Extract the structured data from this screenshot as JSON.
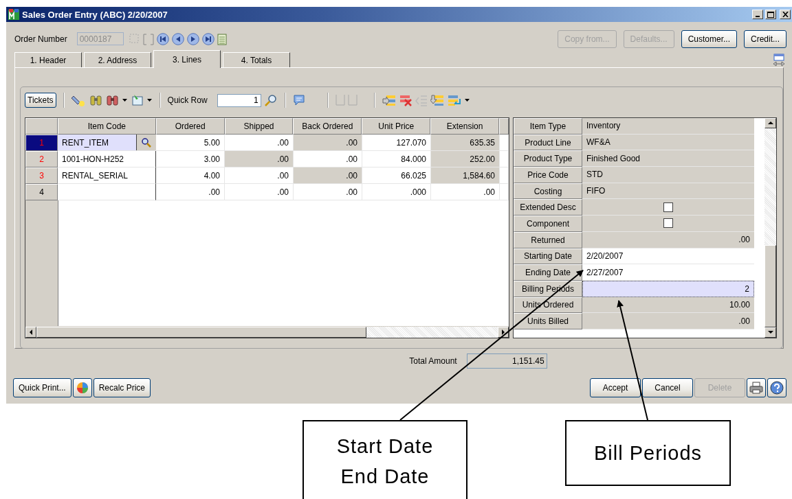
{
  "window": {
    "title": "Sales Order Entry (ABC) 2/20/2007"
  },
  "order": {
    "label": "Order Number",
    "value": "0000187",
    "disabled": true
  },
  "top_buttons": [
    {
      "label": "Copy from...",
      "disabled": true
    },
    {
      "label": "Defaults...",
      "disabled": true
    },
    {
      "label": "Customer...",
      "disabled": false
    },
    {
      "label": "Credit...",
      "disabled": false
    }
  ],
  "tabs": [
    {
      "label": "1. Header",
      "selected": false
    },
    {
      "label": "2. Address",
      "selected": false
    },
    {
      "label": "3. Lines",
      "selected": true
    },
    {
      "label": "4. Totals",
      "selected": false
    }
  ],
  "toolbar": {
    "tickets": "Tickets",
    "quick_row_label": "Quick Row",
    "quick_row_value": "1"
  },
  "grid": {
    "columns": [
      "Item Code",
      "Ordered",
      "Shipped",
      "Back Ordered",
      "Unit Price",
      "Extension"
    ],
    "rows": [
      {
        "number": "1",
        "color": "#ff0000",
        "selected": true,
        "cells": [
          {
            "text": "RENT_ITEM",
            "disabled": false
          },
          {
            "text": "5.00",
            "disabled": false
          },
          {
            "text": ".00",
            "disabled": false
          },
          {
            "text": ".00",
            "disabled": true
          },
          {
            "text": "127.070",
            "disabled": false
          },
          {
            "text": "635.35",
            "disabled": true
          }
        ]
      },
      {
        "number": "2",
        "color": "#ff0000",
        "selected": false,
        "cells": [
          {
            "text": "1001-HON-H252",
            "disabled": false
          },
          {
            "text": "3.00",
            "disabled": false
          },
          {
            "text": ".00",
            "disabled": true
          },
          {
            "text": ".00",
            "disabled": false
          },
          {
            "text": "84.000",
            "disabled": false
          },
          {
            "text": "252.00",
            "disabled": true
          }
        ]
      },
      {
        "number": "3",
        "color": "#ff0000",
        "selected": false,
        "cells": [
          {
            "text": "RENTAL_SERIAL",
            "disabled": false
          },
          {
            "text": "4.00",
            "disabled": false
          },
          {
            "text": ".00",
            "disabled": false
          },
          {
            "text": ".00",
            "disabled": true
          },
          {
            "text": "66.025",
            "disabled": false
          },
          {
            "text": "1,584.60",
            "disabled": true
          }
        ]
      },
      {
        "number": "4",
        "color": "#000000",
        "selected": false,
        "cells": [
          {
            "text": "",
            "disabled": false
          },
          {
            "text": ".00",
            "disabled": false
          },
          {
            "text": ".00",
            "disabled": false
          },
          {
            "text": ".00",
            "disabled": false
          },
          {
            "text": ".000",
            "disabled": false
          },
          {
            "text": ".00",
            "disabled": false
          }
        ]
      }
    ]
  },
  "properties": [
    {
      "label": "Item Type",
      "kind": "text",
      "value": "Inventory",
      "editable": false,
      "focused": false
    },
    {
      "label": "Product Line",
      "kind": "text",
      "value": "WF&A",
      "editable": false,
      "focused": false
    },
    {
      "label": "Product Type",
      "kind": "text",
      "value": "Finished Good",
      "editable": false,
      "focused": false
    },
    {
      "label": "Price Code",
      "kind": "text",
      "value": "STD",
      "editable": false,
      "focused": false
    },
    {
      "label": "Costing",
      "kind": "text",
      "value": "FIFO",
      "editable": false,
      "focused": false
    },
    {
      "label": "Extended Desc",
      "kind": "checkbox",
      "checked": false,
      "editable": false,
      "focused": false
    },
    {
      "label": "Component",
      "kind": "checkbox",
      "checked": false,
      "editable": false,
      "focused": false
    },
    {
      "label": "Returned",
      "kind": "number",
      "value": ".00",
      "editable": false,
      "focused": false
    },
    {
      "label": "Starting Date",
      "kind": "text",
      "value": "2/20/2007",
      "editable": true,
      "focused": false
    },
    {
      "label": "Ending Date",
      "kind": "text",
      "value": "2/27/2007",
      "editable": true,
      "focused": false
    },
    {
      "label": "Billing Periods",
      "kind": "number",
      "value": "2",
      "editable": true,
      "focused": true
    },
    {
      "label": "Units Ordered",
      "kind": "number",
      "value": "10.00",
      "editable": false,
      "focused": false
    },
    {
      "label": "Units Billed",
      "kind": "number",
      "value": ".00",
      "editable": false,
      "focused": false
    }
  ],
  "total": {
    "label": "Total Amount",
    "value": "1,151.45"
  },
  "bottom_left_buttons": [
    {
      "label": "Quick Print...",
      "kind": "text"
    },
    {
      "kind": "icon"
    },
    {
      "label": "Recalc Price",
      "kind": "text"
    }
  ],
  "bottom_right_buttons": [
    {
      "label": "Accept",
      "disabled": false
    },
    {
      "label": "Cancel",
      "disabled": false
    },
    {
      "label": "Delete",
      "disabled": true
    }
  ],
  "callouts": [
    {
      "text": "Start Date\nEnd Date"
    },
    {
      "text": "Bill Periods"
    }
  ]
}
